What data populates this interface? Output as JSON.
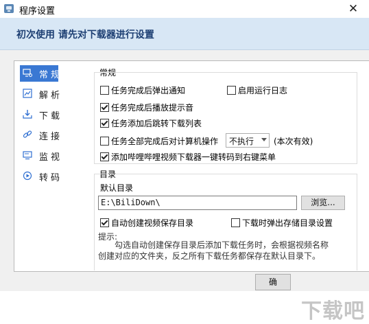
{
  "window": {
    "title": "程序设置",
    "close": "✕"
  },
  "header": {
    "text": "初次使用  请先对下载器进行设置"
  },
  "sidebar": {
    "items": [
      {
        "label": "常规",
        "icon": "monitor-gear-icon",
        "selected": true
      },
      {
        "label": "解析",
        "icon": "chart-icon"
      },
      {
        "label": "下载",
        "icon": "download-icon"
      },
      {
        "label": "连接",
        "icon": "link-icon"
      },
      {
        "label": "监视",
        "icon": "screen-icon"
      },
      {
        "label": "转码",
        "icon": "transcode-icon"
      }
    ]
  },
  "general": {
    "title": "常规",
    "notify_popup": {
      "label": "任务完成后弹出通知",
      "checked": false
    },
    "enable_log": {
      "label": "启用运行日志",
      "checked": false
    },
    "play_sound": {
      "label": "任务完成后播放提示音",
      "checked": true
    },
    "jump_list": {
      "label": "任务添加后跳转下载列表",
      "checked": true
    },
    "all_done_action": {
      "label": "任务全部完成后对计算机操作",
      "checked": false
    },
    "action_select": {
      "value": "不执行"
    },
    "action_note": "(本次有效)",
    "context_menu": {
      "label": "添加哔哩哔哩视频下载器一键转码到右键菜单",
      "checked": true
    }
  },
  "directory": {
    "title": "目录",
    "default_label": "默认目录",
    "path": "E:\\BiliDown\\",
    "browse_label": "浏览...",
    "auto_create": {
      "label": "自动创建视频保存目录",
      "checked": true
    },
    "popup_on_download": {
      "label": "下载时弹出存储目录设置",
      "checked": false
    }
  },
  "hint": {
    "title": "提示:",
    "line1": "勾选自动创建保存目录后添加下载任务时，会根据视频名称",
    "line2": "创建对应的文件夹，反之所有下载任务都保存在默认目录下。"
  },
  "footer": {
    "ok_label": "确"
  },
  "watermark": "下载吧"
}
